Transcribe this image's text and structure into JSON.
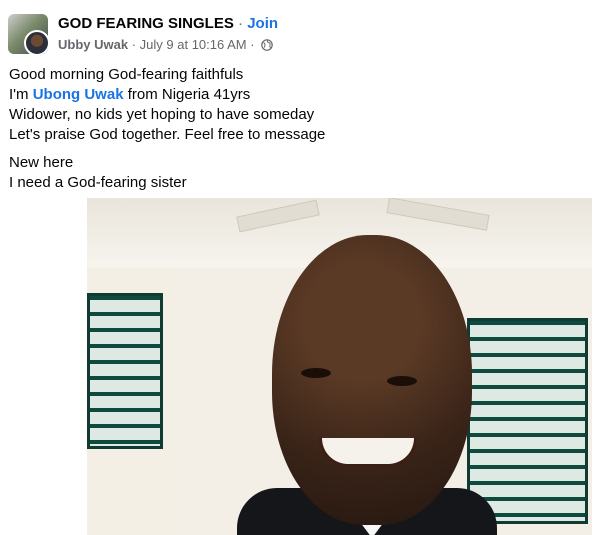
{
  "group": {
    "name": "GOD FEARING SINGLES",
    "separator": "·",
    "join_label": "Join"
  },
  "post_meta": {
    "author": "Ubby Uwak",
    "separator": "·",
    "timestamp": "July 9 at 10:16 AM",
    "privacy_icon": "globe-icon"
  },
  "post": {
    "line1": "Good morning God-fearing faithfuls",
    "line2_prefix": "I'm ",
    "line2_mention": "Ubong Uwak",
    "line2_suffix": " from Nigeria 41yrs",
    "line3": "Widower, no kids yet hoping to have someday",
    "line4": "Let's praise God together. Feel free to message",
    "line5": "New here",
    "line6": "I need a God-fearing sister"
  },
  "colors": {
    "link": "#1b74e4",
    "meta": "#65676b",
    "text": "#050505"
  }
}
